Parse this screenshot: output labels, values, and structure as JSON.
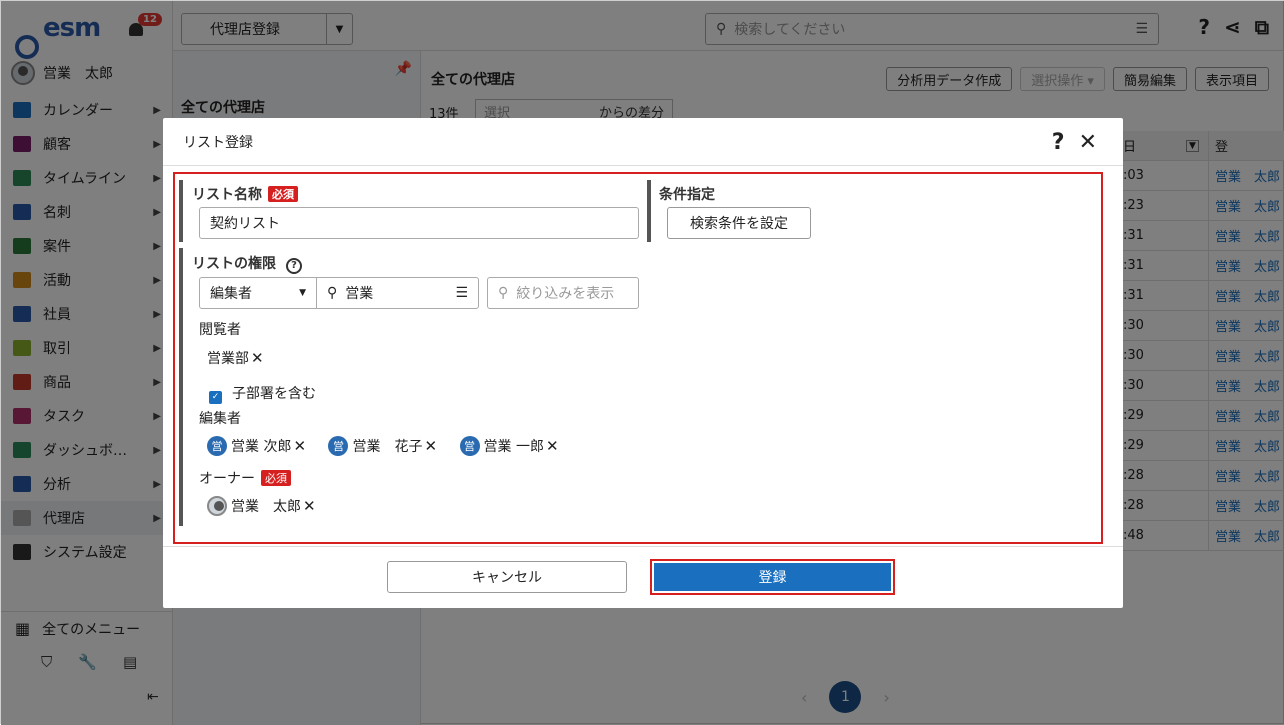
{
  "app": {
    "logo": "esm",
    "notification_count": "12"
  },
  "user": {
    "name": "営業　太郎"
  },
  "nav": {
    "items": [
      {
        "label": "カレンダー",
        "color": "#1a6fbf"
      },
      {
        "label": "顧客",
        "color": "#7a1f6a"
      },
      {
        "label": "タイムライン",
        "color": "#2e8b57"
      },
      {
        "label": "名刺",
        "color": "#2a5aa8"
      },
      {
        "label": "案件",
        "color": "#2a7a3a"
      },
      {
        "label": "活動",
        "color": "#d18a1a"
      },
      {
        "label": "社員",
        "color": "#2a5aa8"
      },
      {
        "label": "取引",
        "color": "#8ab02a"
      },
      {
        "label": "商品",
        "color": "#c0392b"
      },
      {
        "label": "タスク",
        "color": "#b0306a"
      },
      {
        "label": "ダッシュボ…",
        "color": "#2a8a5a"
      },
      {
        "label": "分析",
        "color": "#2a5aa8"
      },
      {
        "label": "代理店",
        "color": "#aaaaaa"
      },
      {
        "label": "システム設定",
        "color": "#333333"
      }
    ],
    "all_menu": "全てのメニュー"
  },
  "topbar": {
    "register_label": "代理店登録",
    "search_placeholder": "検索してください"
  },
  "listpanel": {
    "title": "全ての代理店"
  },
  "main": {
    "title": "全ての代理店",
    "buttons": [
      "分析用データ作成",
      "選択操作 ▾",
      "簡易編集",
      "表示項目"
    ],
    "count": "13件",
    "diff_select": "選択",
    "diff_label": "からの差分",
    "grid_header": "日",
    "rows": [
      {
        "time": ":03",
        "user": "営業　太郎"
      },
      {
        "time": ":23",
        "user": "営業　太郎"
      },
      {
        "time": ":31",
        "user": "営業　太郎"
      },
      {
        "time": ":31",
        "user": "営業　太郎"
      },
      {
        "time": ":31",
        "user": "営業　太郎"
      },
      {
        "time": ":30",
        "user": "営業　太郎"
      },
      {
        "time": ":30",
        "user": "営業　太郎"
      },
      {
        "time": ":30",
        "user": "営業　太郎"
      },
      {
        "time": ":29",
        "user": "営業　太郎"
      },
      {
        "time": ":29",
        "user": "営業　太郎"
      },
      {
        "time": ":28",
        "user": "営業　太郎"
      },
      {
        "time": ":28",
        "user": "営業　太郎"
      },
      {
        "time": ":48",
        "user": "営業　太郎"
      }
    ],
    "page": "1"
  },
  "modal": {
    "title": "リスト登録",
    "list_name_label": "リスト名称",
    "required": "必須",
    "list_name_value": "契約リスト",
    "condition_label": "条件指定",
    "condition_button": "検索条件を設定",
    "permission_label": "リストの権限",
    "role_select": "編集者",
    "search_value": "営業",
    "filter_placeholder": "絞り込みを表示",
    "viewer_label": "閲覧者",
    "viewer_dept": "営業部",
    "include_sub": "子部署を含む",
    "editor_label": "編集者",
    "editors": [
      "営業 次郎",
      "営業　花子",
      "営業 一郎"
    ],
    "editor_icon_text": "営",
    "owner_label": "オーナー",
    "owner_name": "営業　太郎",
    "cancel": "キャンセル",
    "submit": "登録"
  }
}
